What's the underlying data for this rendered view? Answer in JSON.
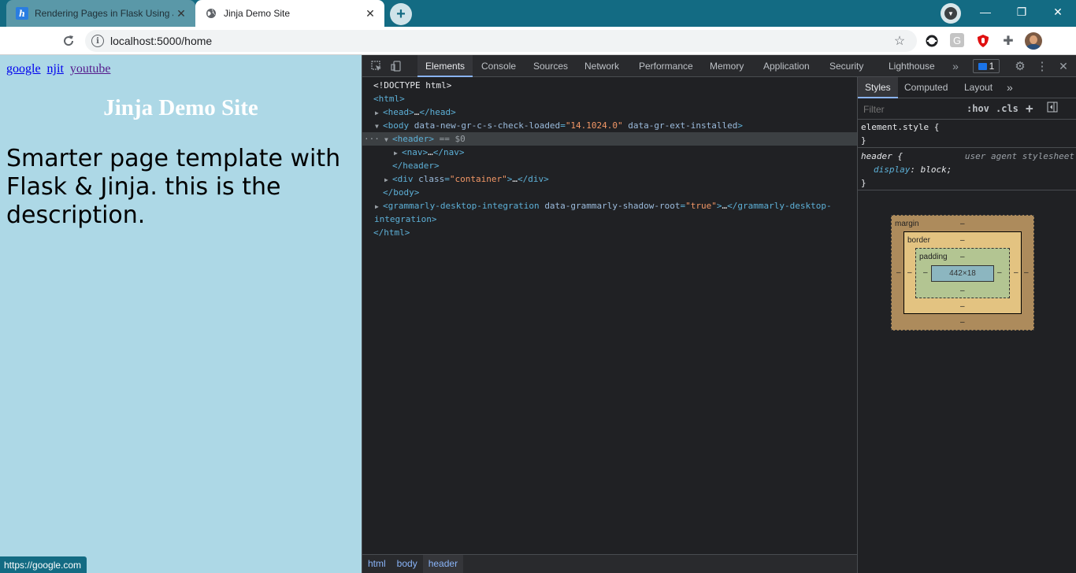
{
  "tabs": [
    {
      "title": "Rendering Pages in Flask Using Jinja",
      "favicon": "h",
      "active": false
    },
    {
      "title": "Jinja Demo Site",
      "active": true
    }
  ],
  "address": {
    "url": "localhost:5000/home"
  },
  "page": {
    "nav_links": [
      "google",
      "njit",
      "youtube"
    ],
    "heading": "Jinja Demo Site",
    "description": "Smarter page template with Flask & Jinja. this is the description.",
    "status_url": "https://google.com"
  },
  "devtools": {
    "tabs": [
      "Elements",
      "Console",
      "Sources",
      "Network",
      "Performance",
      "Memory",
      "Application",
      "Security",
      "Lighthouse"
    ],
    "issues_count": "1",
    "dom": {
      "doctype": "<!DOCTYPE html>",
      "html_open": "<html>",
      "head": "<head>",
      "head_close": "</head>",
      "body_tag": "<body",
      "body_attr1": "data-new-gr-c-s-check-loaded",
      "body_attr1_val": "\"14.1024.0\"",
      "body_attr2": "data-gr-ext-installed",
      "header_open": "<header>",
      "header_marker": "== $0",
      "nav_open": "<nav>",
      "nav_close": "</nav>",
      "header_close": "</header>",
      "div_tag": "<div",
      "div_attr": "class",
      "div_val": "\"container\"",
      "div_close": "</div>",
      "body_close": "</body>",
      "gram_tag": "<grammarly-desktop-integration",
      "gram_attr": "data-grammarly-shadow-root",
      "gram_val": "\"true\"",
      "gram_close1": "</grammarly-desktop-",
      "gram_close2": "integration>",
      "html_close": "</html>",
      "ellipsis": "…"
    },
    "breadcrumbs": [
      "html",
      "body",
      "header"
    ],
    "side_tabs": [
      "Styles",
      "Computed",
      "Layout"
    ],
    "filter_placeholder": "Filter",
    "hov": ":hov",
    "cls": ".cls",
    "styles": {
      "element_style": "element.style {",
      "close_brace": "}",
      "header_selector": "header {",
      "ua_label": "user agent stylesheet",
      "prop_name": "display",
      "prop_value": "block;"
    },
    "box_model": {
      "margin_label": "margin",
      "border_label": "border",
      "padding_label": "padding",
      "content_size": "442×18",
      "dash": "–"
    }
  }
}
